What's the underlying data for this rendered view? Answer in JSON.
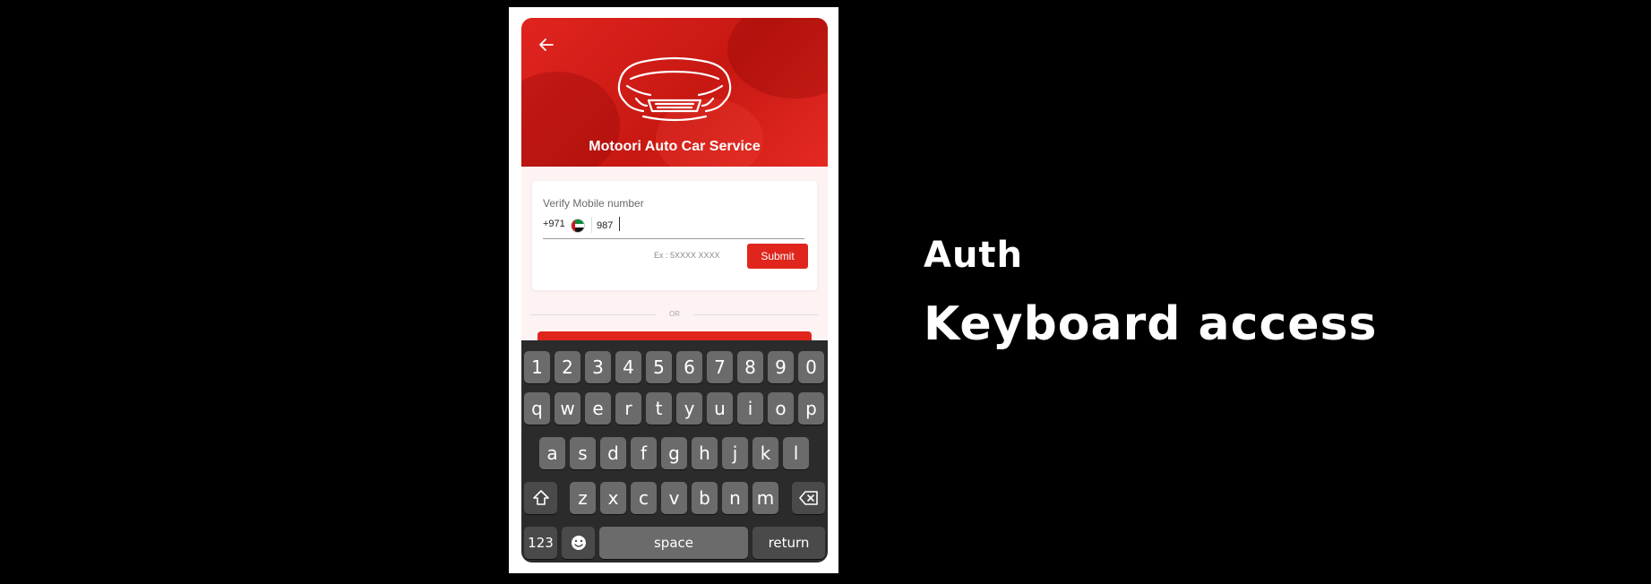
{
  "header": {
    "brand_name": "Motoori Auto Car Service",
    "back_icon": "arrow-left-icon"
  },
  "verify": {
    "label": "Verify Mobile number",
    "country_code": "+971",
    "flag_icon": "uae-flag-icon",
    "phone_value": "987",
    "hint": "Ex : 5XXXX XXXX",
    "submit_label": "Submit"
  },
  "divider": {
    "text": "OR"
  },
  "keyboard": {
    "row1": [
      "1",
      "2",
      "3",
      "4",
      "5",
      "6",
      "7",
      "8",
      "9",
      "0"
    ],
    "row2": [
      "q",
      "w",
      "e",
      "r",
      "t",
      "y",
      "u",
      "i",
      "o",
      "p"
    ],
    "row3": [
      "a",
      "s",
      "d",
      "f",
      "g",
      "h",
      "j",
      "k",
      "l"
    ],
    "row4": [
      "z",
      "x",
      "c",
      "v",
      "b",
      "n",
      "m"
    ],
    "shift_icon": "shift-icon",
    "backspace_icon": "backspace-icon",
    "numbers_label": "123",
    "emoji_icon": "emoji-icon",
    "space_label": "space",
    "return_label": "return"
  },
  "side": {
    "title": "Auth",
    "subtitle": "Keyboard access"
  },
  "colors": {
    "brand_red": "#e0261c",
    "keyboard_bg": "#2b2b2b",
    "key_bg": "#6b6b6b"
  }
}
